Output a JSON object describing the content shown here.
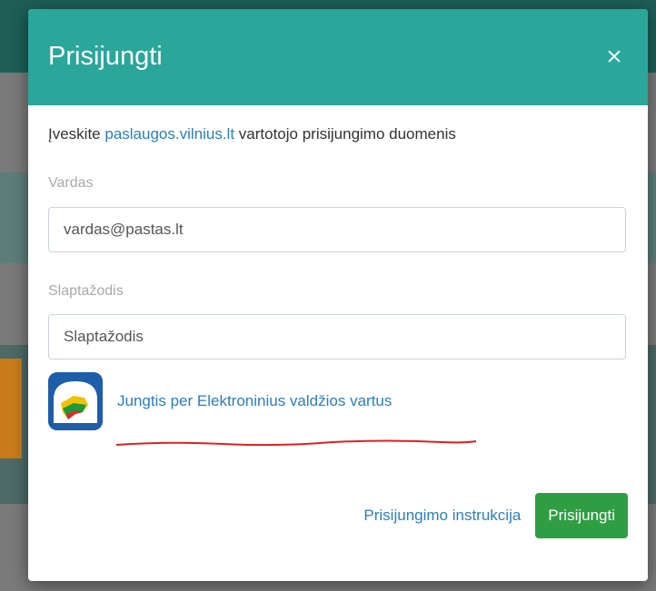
{
  "modal": {
    "title": "Prisijungti",
    "close_glyph": "×",
    "intro_prefix": "Įveskite ",
    "intro_link": "paslaugos.vilnius.lt",
    "intro_suffix": " vartotojo prisijungimo duomenis",
    "username": {
      "label": "Vardas",
      "placeholder": "vardas@pastas.lt",
      "value": ""
    },
    "password": {
      "label": "Slaptažodis",
      "placeholder": "Slaptažodis",
      "value": ""
    },
    "egov_link": "Jungtis per Elektroninius valdžios vartus",
    "instructions_link": "Prisijungimo instrukcija",
    "submit_label": "Prisijungti"
  },
  "colors": {
    "header": "#2aa69a",
    "link": "#2a7fbf",
    "submit": "#2f9e43",
    "annotation": "#e02020"
  },
  "icons": {
    "close": "close-icon",
    "egov": "egov-logo-icon"
  }
}
